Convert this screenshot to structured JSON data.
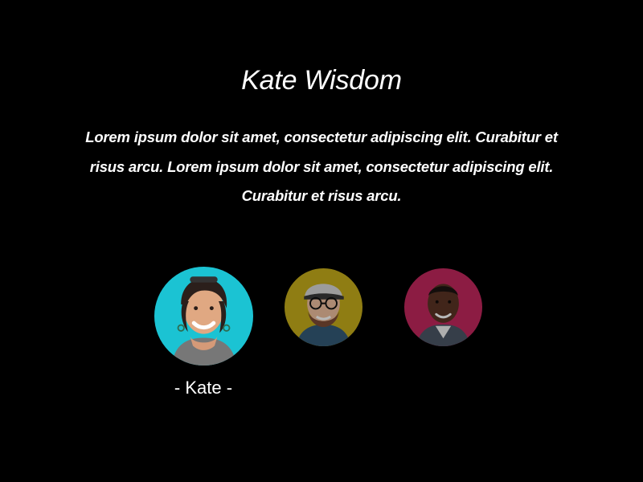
{
  "testimonial": {
    "title": "Kate Wisdom",
    "quote": "Lorem ipsum dolor sit amet, consectetur adipiscing elit. Curabitur et risus arcu. Lorem ipsum dolor sit amet, consectetur adipiscing elit. Curabitur et risus arcu.",
    "selected_name": "- Kate -"
  },
  "avatars": [
    {
      "id": "kate",
      "background": "#1bc3d3",
      "active": true
    },
    {
      "id": "second-person",
      "background": "#c7ad1b",
      "active": false
    },
    {
      "id": "third-person",
      "background": "#c3285d",
      "active": false
    }
  ]
}
